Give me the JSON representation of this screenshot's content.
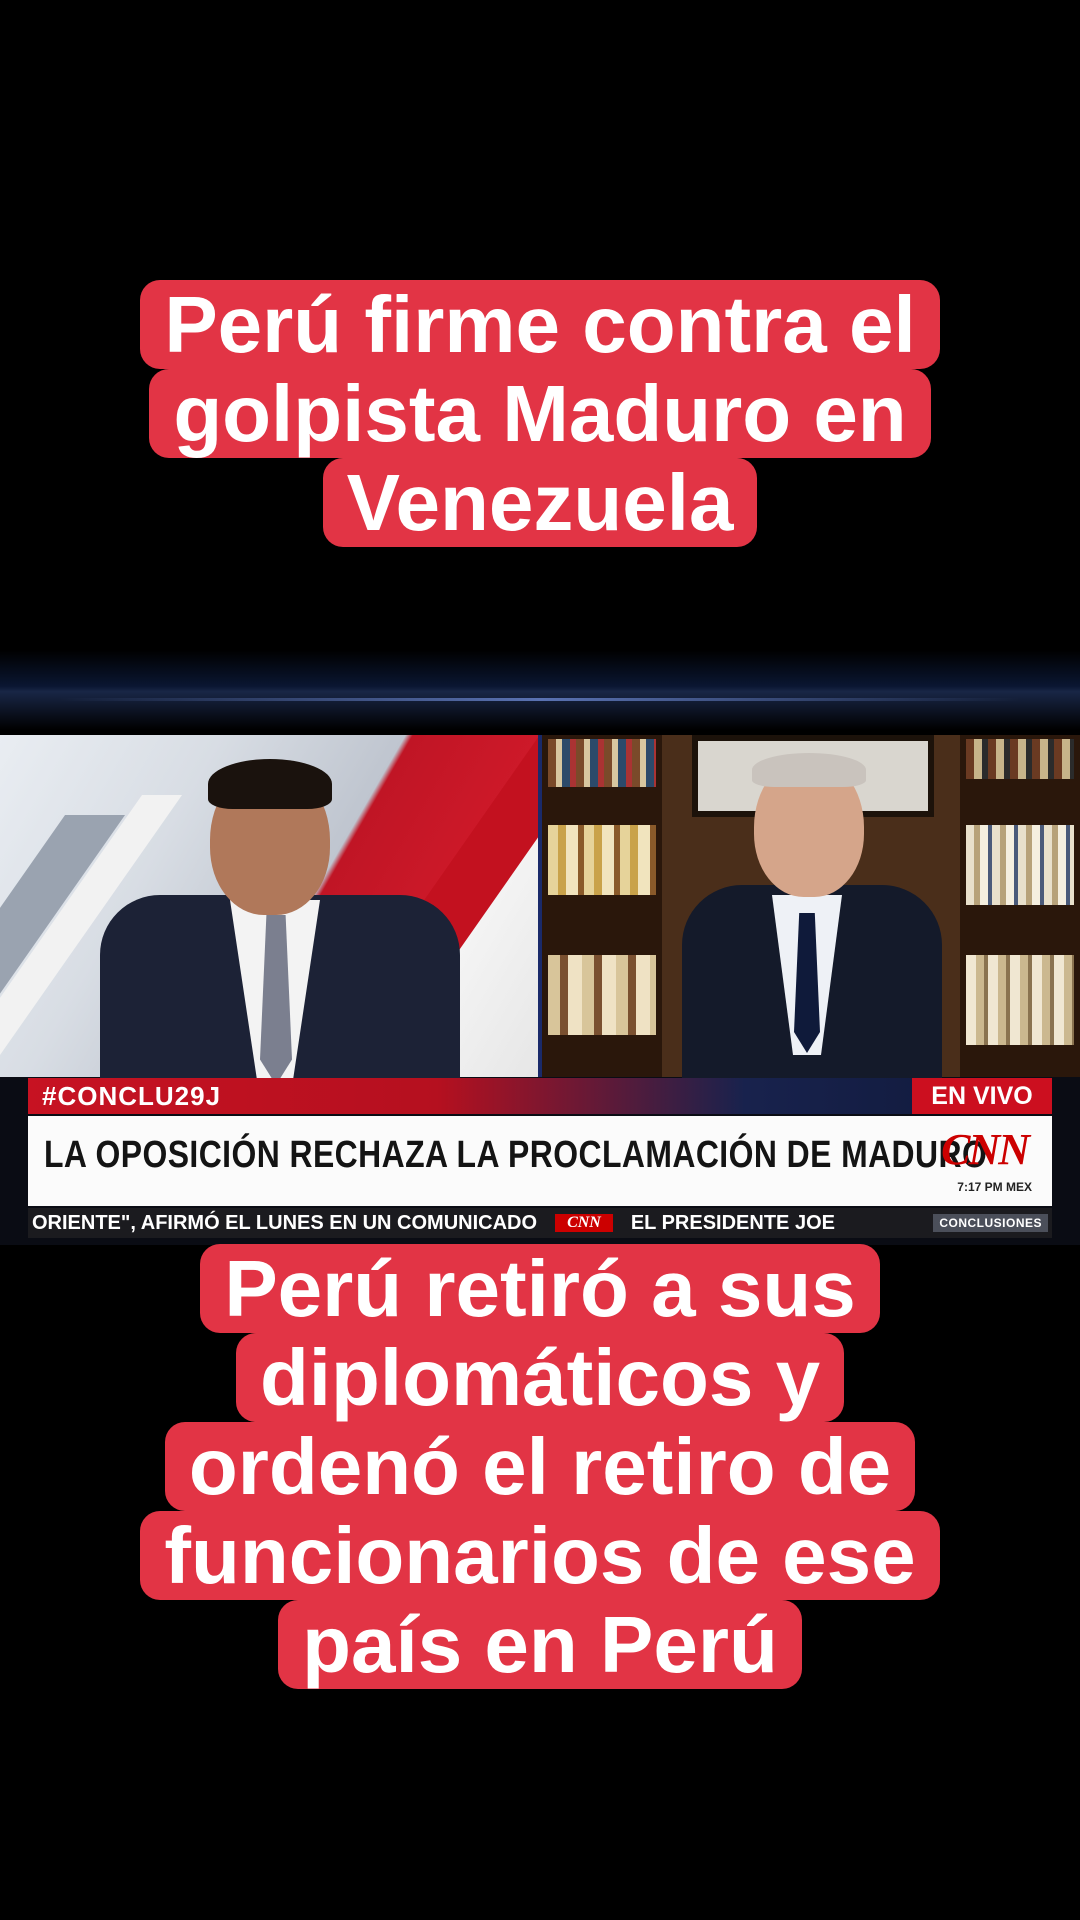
{
  "captions": {
    "top": [
      "Perú firme contra el",
      "golpista Maduro en",
      "Venezuela"
    ],
    "bottom": [
      "Perú retiró a sus",
      "diplomáticos y",
      "ordenó el retiro de",
      "funcionarios de ese",
      "país en Perú"
    ]
  },
  "broadcast": {
    "hashtag": "#CONCLU29J",
    "live_label": "EN VIVO",
    "headline": "LA OPOSICIÓN RECHAZA LA PROCLAMACIÓN DE MADURO",
    "network": "CNN",
    "time": "7:17 PM MEX",
    "ticker_left": "ORIENTE\", AFIRMÓ EL LUNES EN UN COMUNICADO",
    "ticker_sep": "CNN",
    "ticker_right": "EL PRESIDENTE JOE",
    "program_badge": "CONCLUSIONES"
  },
  "colors": {
    "caption_bg": "#e23445",
    "caption_text": "#ffffff",
    "cnn_red": "#cc0000"
  }
}
